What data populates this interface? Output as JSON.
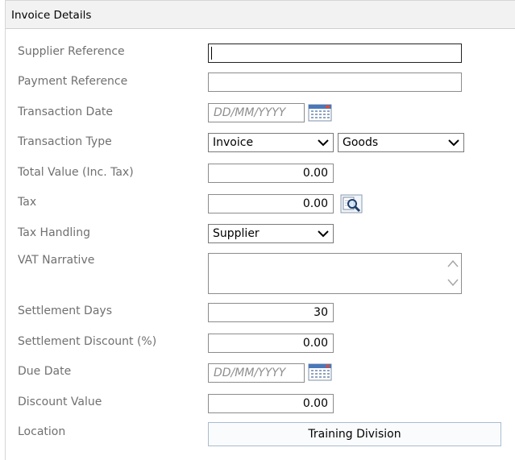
{
  "panel": {
    "title": "Invoice Details"
  },
  "fields": {
    "supplier_reference": {
      "label": "Supplier Reference",
      "value": ""
    },
    "payment_reference": {
      "label": "Payment Reference",
      "value": ""
    },
    "transaction_date": {
      "label": "Transaction Date",
      "placeholder": "DD/MM/YYYY"
    },
    "transaction_type": {
      "label": "Transaction Type",
      "type_selected": "Invoice",
      "category_selected": "Goods"
    },
    "total_value": {
      "label": "Total Value (Inc. Tax)",
      "value": "0.00"
    },
    "tax": {
      "label": "Tax",
      "value": "0.00"
    },
    "tax_handling": {
      "label": "Tax Handling",
      "selected": "Supplier"
    },
    "vat_narrative": {
      "label": "VAT Narrative",
      "value": ""
    },
    "settlement_days": {
      "label": "Settlement Days",
      "value": "30"
    },
    "settlement_discount": {
      "label": "Settlement Discount (%)",
      "value": "0.00"
    },
    "due_date": {
      "label": "Due Date",
      "placeholder": "DD/MM/YYYY"
    },
    "discount_value": {
      "label": "Discount Value",
      "value": "0.00"
    },
    "location": {
      "label": "Location",
      "value": "Training Division"
    }
  },
  "icons": {
    "calendar": "calendar-icon",
    "magnifier": "magnifier-icon",
    "dropdown": "chevron-down-icon"
  }
}
